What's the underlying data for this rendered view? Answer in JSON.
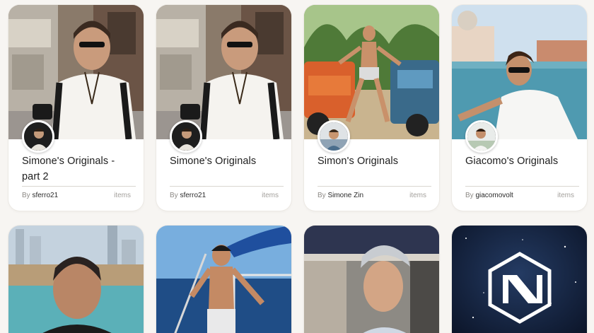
{
  "collections": [
    {
      "title": "Simone's Originals - part 2",
      "by_label": "By",
      "creator": "sferro21",
      "items_label": "items"
    },
    {
      "title": "Simone's Originals",
      "by_label": "By",
      "creator": "sferro21",
      "items_label": "items"
    },
    {
      "title": "Simon's Originals",
      "by_label": "By",
      "creator": "Simone Zin",
      "items_label": "items"
    },
    {
      "title": "Giacomo's Originals",
      "by_label": "By",
      "creator": "giacomovolt",
      "items_label": "items"
    }
  ],
  "colors": {
    "page_bg": "#f7f5f2",
    "card_bg": "#ffffff",
    "divider": "#d9d6d1",
    "muted_text": "#8d8a86"
  }
}
